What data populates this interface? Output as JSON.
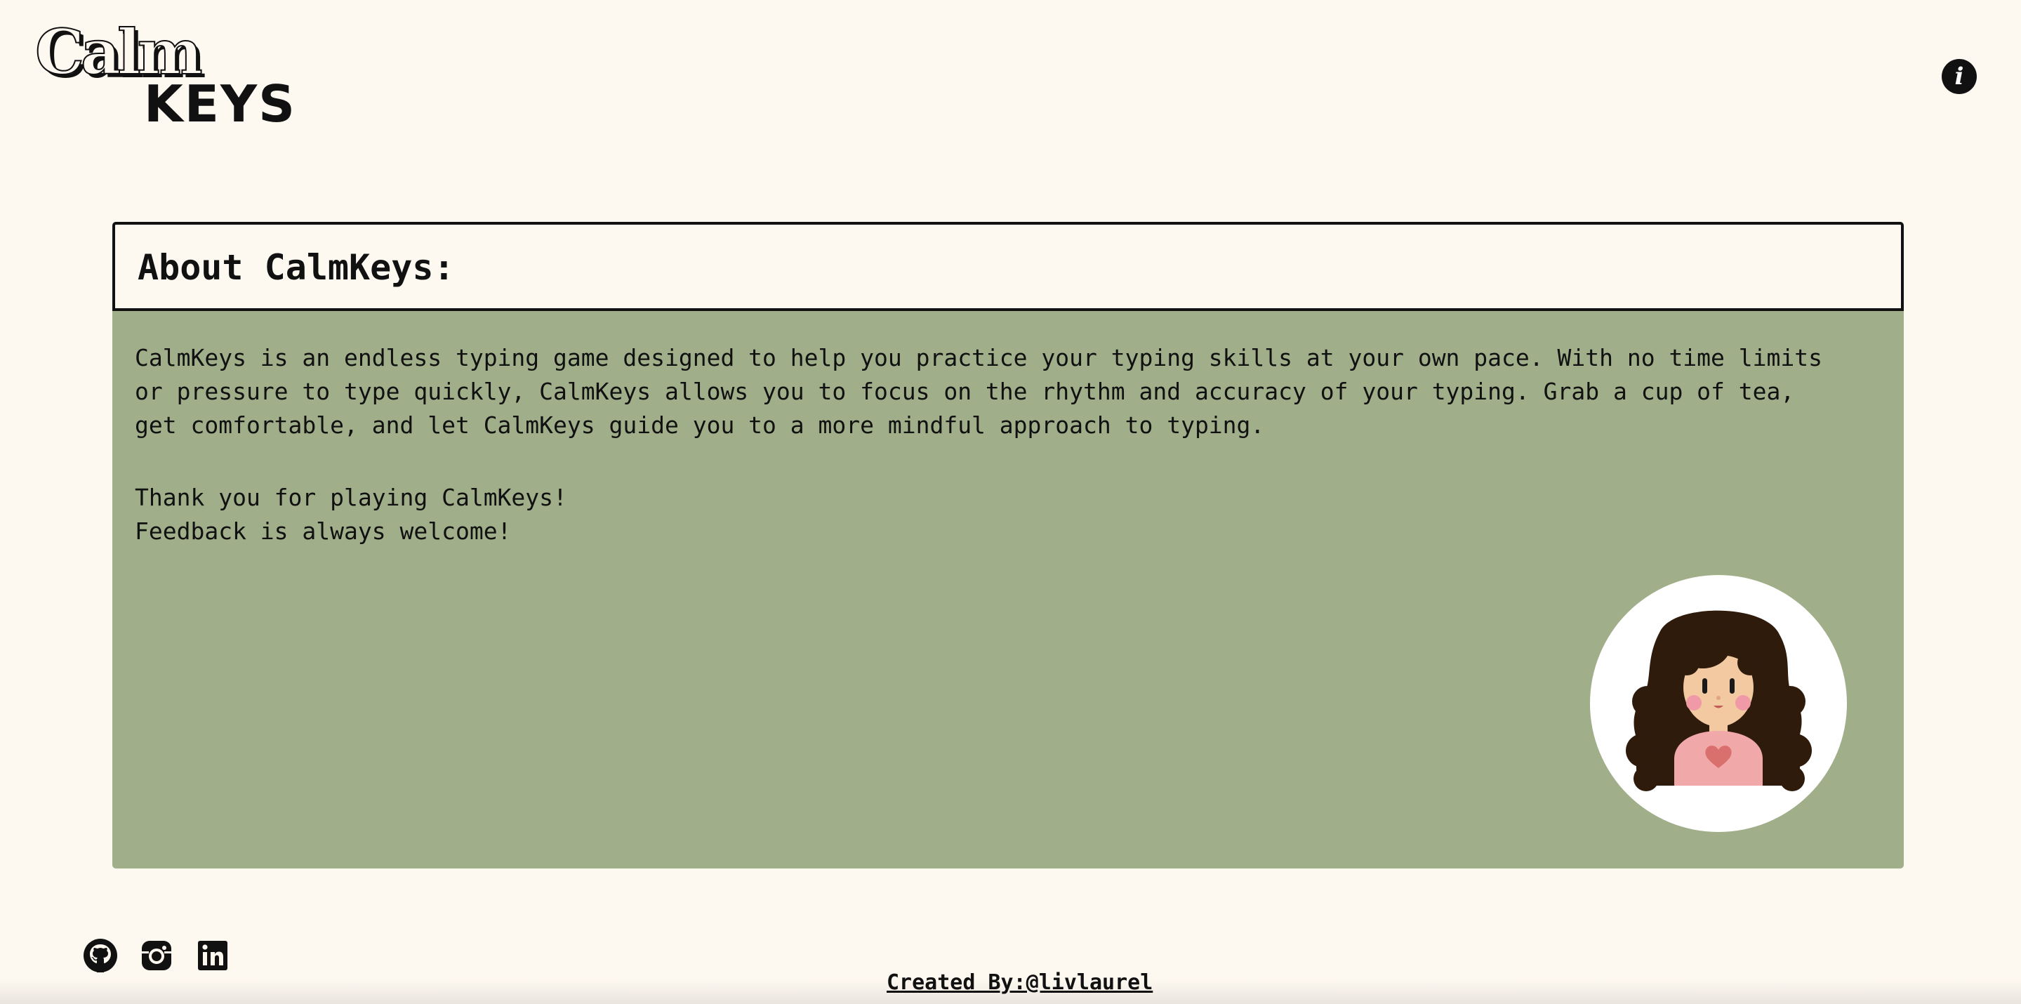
{
  "logo": {
    "line1": "Calm",
    "line2": "KEYS"
  },
  "header": {
    "info_icon": "info-icon"
  },
  "about": {
    "title": "About CalmKeys:",
    "paragraph1": "CalmKeys is an endless typing game designed to help you practice your typing skills at your own pace. With no time limits or pressure to type quickly, CalmKeys allows you to focus on the rhythm and accuracy of your typing. Grab a cup of tea, get comfortable, and let CalmKeys guide you to a more mindful approach to typing.",
    "paragraph2": "Thank you for playing CalmKeys!\nFeedback is always welcome!"
  },
  "avatar": {
    "icon": "girl-avatar-icon"
  },
  "footer": {
    "social_icons": [
      "github-icon",
      "instagram-icon",
      "linkedin-icon"
    ],
    "credit": "Created By:@livlaurel"
  },
  "colors": {
    "background": "#fdf8f0",
    "panel": "#a0ae8a",
    "text": "#111111",
    "hair": "#2e1b0c",
    "skin": "#f2c9a1",
    "shirt": "#f0a8a8",
    "heart": "#d9706e"
  }
}
